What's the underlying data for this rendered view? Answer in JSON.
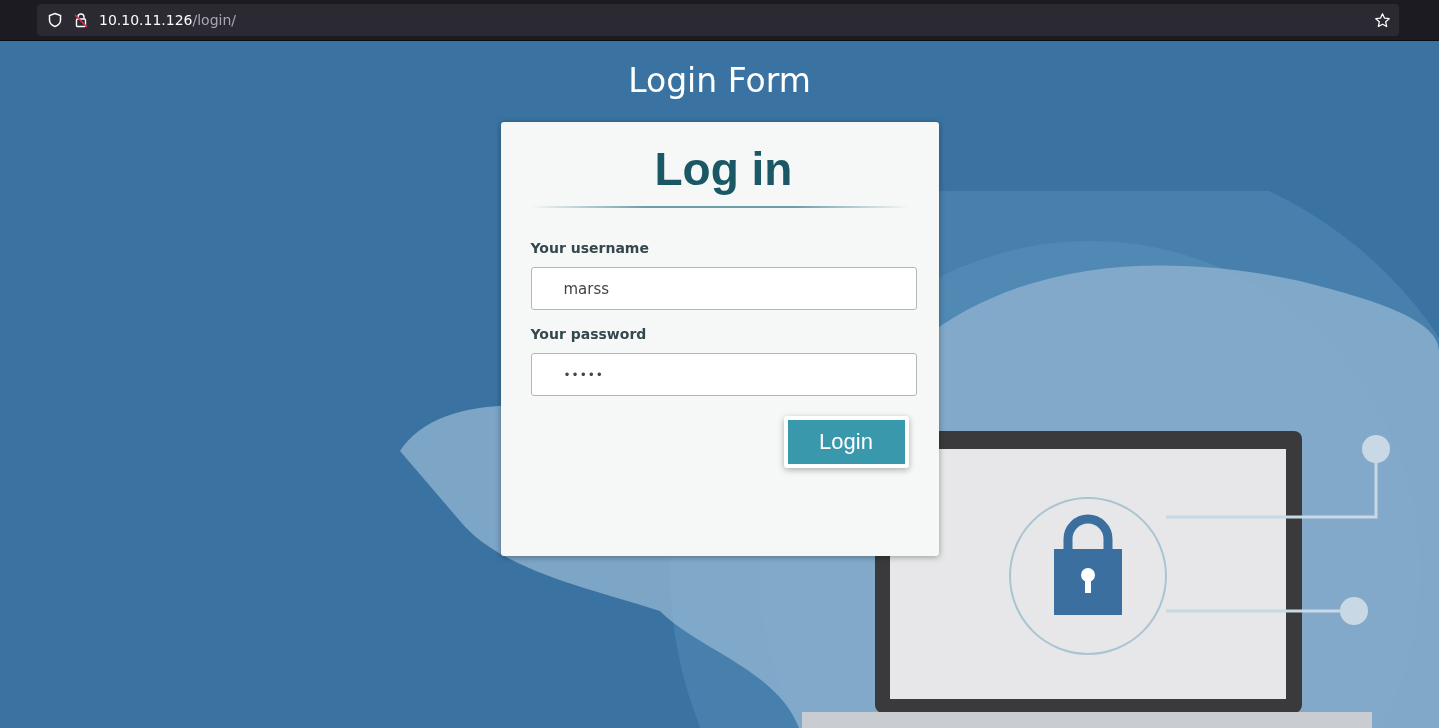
{
  "browser": {
    "url": {
      "host": "10.10.11.126",
      "path": "/login/"
    }
  },
  "page_title": "Login Form",
  "form": {
    "heading": "Log in",
    "fields": [
      {
        "label": "Your username",
        "value": "marss",
        "kind": "text"
      },
      {
        "label": "Your password",
        "value": "•••••",
        "kind": "password"
      }
    ],
    "button": "Login"
  }
}
